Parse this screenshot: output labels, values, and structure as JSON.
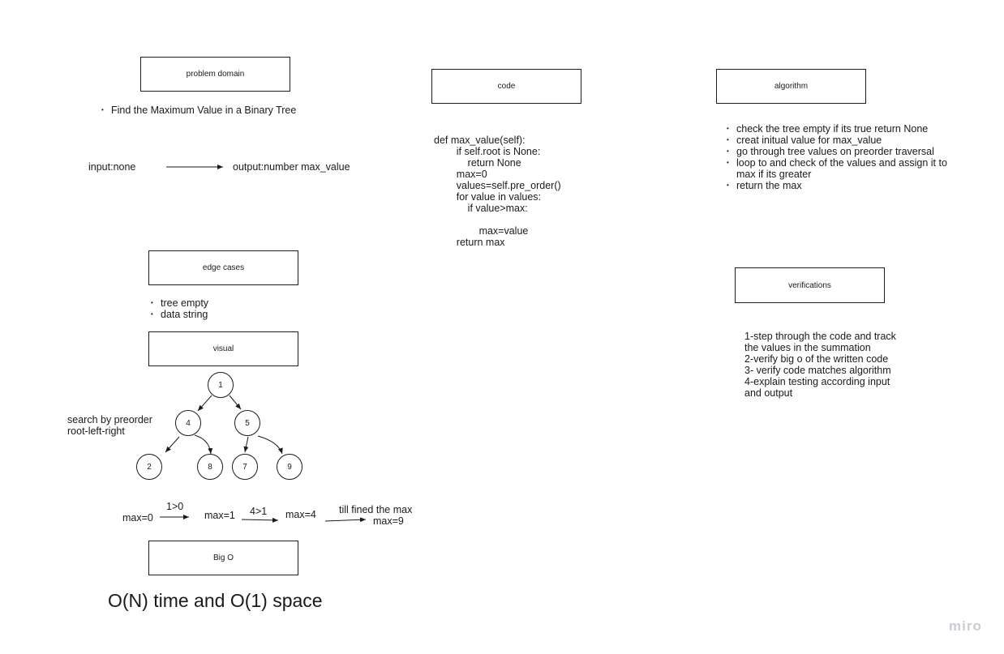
{
  "boxes": {
    "problem_domain": "problem domain",
    "code": "code",
    "algorithm": "algorithm",
    "edge_cases": "edge cases",
    "visual": "visual",
    "verifications": "verifications",
    "big_o": "Big O"
  },
  "problem": {
    "items": [
      "Find the Maximum Value in a Binary Tree"
    ],
    "input": "input:none",
    "output": "output:number max_value"
  },
  "code": {
    "text": "def max_value(self):\n        if self.root is None:\n            return None\n        max=0\n        values=self.pre_order()\n        for value in values:\n            if value>max:\n\n                max=value\n        return max"
  },
  "algorithm": {
    "items": [
      "check the tree empty if its true return None",
      "creat initual value for max_value",
      "go through tree values on preorder traversal",
      "loop to and check of the values and assign it to max if its greater",
      "return the max"
    ]
  },
  "edge_cases": {
    "items": [
      "tree empty",
      "data string"
    ]
  },
  "verifications": {
    "lines": [
      "1-step through the code and track",
      "the values in the summation",
      "2-verify big o of the written code",
      "3- verify code matches algorithm",
      "4-explain testing according input",
      "and output"
    ]
  },
  "visual": {
    "search_label_1": "search by preorder",
    "search_label_2": "root-left-right",
    "nodes": [
      "1",
      "4",
      "5",
      "2",
      "8",
      "7",
      "9"
    ],
    "steps": {
      "max0": "max=0",
      "cmp1": "1>0",
      "max1": "max=1",
      "cmp2": "4>1",
      "max4": "max=4",
      "till": "till fined the max",
      "max9": "max=9"
    }
  },
  "big_o": {
    "text": "O(N) time and O(1) space"
  },
  "watermark": "miro"
}
